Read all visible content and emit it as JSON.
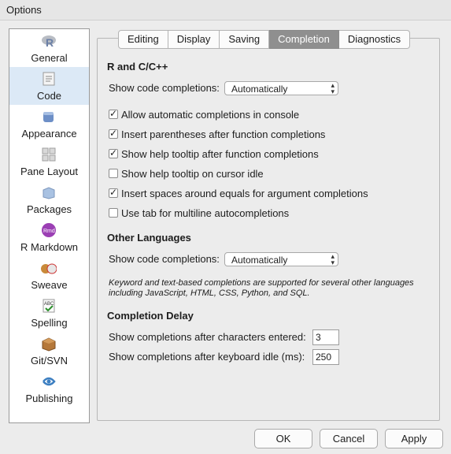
{
  "window": {
    "title": "Options"
  },
  "sidebar": {
    "items": [
      {
        "label": "General",
        "icon": "r-logo-icon"
      },
      {
        "label": "Code",
        "icon": "code-document-icon"
      },
      {
        "label": "Appearance",
        "icon": "paint-bucket-icon"
      },
      {
        "label": "Pane Layout",
        "icon": "pane-grid-icon"
      },
      {
        "label": "Packages",
        "icon": "package-box-icon"
      },
      {
        "label": "R Markdown",
        "icon": "rmd-badge-icon"
      },
      {
        "label": "Sweave",
        "icon": "sweave-pdf-icon"
      },
      {
        "label": "Spelling",
        "icon": "spellcheck-abc-icon"
      },
      {
        "label": "Git/SVN",
        "icon": "git-box-icon"
      },
      {
        "label": "Publishing",
        "icon": "publish-swirl-icon"
      }
    ],
    "active": "Code"
  },
  "tabs": [
    {
      "label": "Editing"
    },
    {
      "label": "Display"
    },
    {
      "label": "Saving"
    },
    {
      "label": "Completion"
    },
    {
      "label": "Diagnostics"
    }
  ],
  "active_tab": "Completion",
  "r_section": {
    "heading": "R and C/C++",
    "show_completions_label": "Show code completions:",
    "show_completions_value": "Automatically",
    "checkboxes": [
      {
        "label": "Allow automatic completions in console",
        "checked": true
      },
      {
        "label": "Insert parentheses after function completions",
        "checked": true
      },
      {
        "label": "Show help tooltip after function completions",
        "checked": true
      },
      {
        "label": "Show help tooltip on cursor idle",
        "checked": false
      },
      {
        "label": "Insert spaces around equals for argument completions",
        "checked": true
      },
      {
        "label": "Use tab for multiline autocompletions",
        "checked": false
      }
    ]
  },
  "other_section": {
    "heading": "Other Languages",
    "show_completions_label": "Show code completions:",
    "show_completions_value": "Automatically",
    "note": "Keyword and text-based completions are supported for several other languages including JavaScript, HTML, CSS, Python, and SQL."
  },
  "delay_section": {
    "heading": "Completion Delay",
    "chars_label": "Show completions after characters entered:",
    "chars_value": "3",
    "idle_label": "Show completions after keyboard idle (ms):",
    "idle_value": "250"
  },
  "buttons": {
    "ok": "OK",
    "cancel": "Cancel",
    "apply": "Apply"
  },
  "check_glyph": "✓",
  "chevron_glyph": "⌃⌄"
}
